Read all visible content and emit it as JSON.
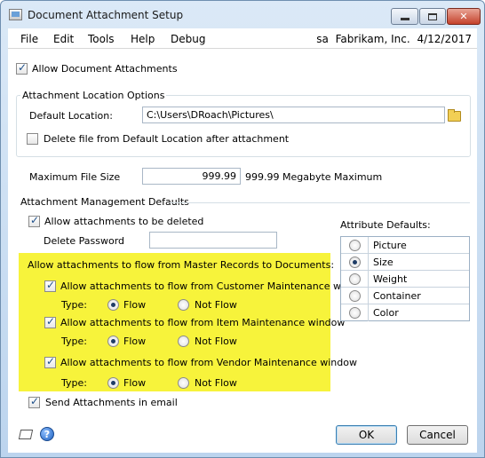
{
  "window": {
    "title": "Document Attachment Setup"
  },
  "menubar": {
    "items": [
      "File",
      "Edit",
      "Tools",
      "Help",
      "Debug"
    ],
    "user": "sa",
    "company": "Fabrikam, Inc.",
    "date": "4/12/2017"
  },
  "allow_document_attachments": {
    "label": "Allow Document Attachments",
    "checked": true
  },
  "attachment_location": {
    "group_label": "Attachment Location Options",
    "default_location_label": "Default Location:",
    "default_location_value": "C:\\Users\\DRoach\\Pictures\\",
    "delete_file_label": "Delete file from Default Location after attachment",
    "delete_file_checked": false
  },
  "max_file_size": {
    "label": "Maximum File Size",
    "value": "999.99",
    "hint": "999.99 Megabyte Maximum"
  },
  "management": {
    "group_label": "Attachment Management Defaults",
    "allow_delete_label": "Allow attachments to be deleted",
    "allow_delete_checked": true,
    "delete_password_label": "Delete Password",
    "delete_password_value": "",
    "flow_heading": "Allow attachments to flow from Master Records to Documents:",
    "type_label": "Type:",
    "flow_label": "Flow",
    "not_flow_label": "Not Flow",
    "flows": [
      {
        "label": "Allow attachments to flow from Customer Maintenance window",
        "checked": true,
        "selected": "Flow"
      },
      {
        "label": "Allow attachments to flow from Item Maintenance window",
        "checked": true,
        "selected": "Flow"
      },
      {
        "label": "Allow attachments to flow from Vendor Maintenance window",
        "checked": true,
        "selected": "Flow"
      }
    ],
    "send_email_label": "Send Attachments in email",
    "send_email_checked": true
  },
  "attribute_defaults": {
    "label": "Attribute Defaults:",
    "options": [
      "Picture",
      "Size",
      "Weight",
      "Container",
      "Color"
    ],
    "selected": "Size"
  },
  "buttons": {
    "ok": "OK",
    "cancel": "Cancel"
  },
  "icons": [
    "note-icon",
    "help-icon",
    "folder-icon"
  ],
  "colors": {
    "highlight": "#f7f33b",
    "window_frame": "#bcd4ee"
  }
}
